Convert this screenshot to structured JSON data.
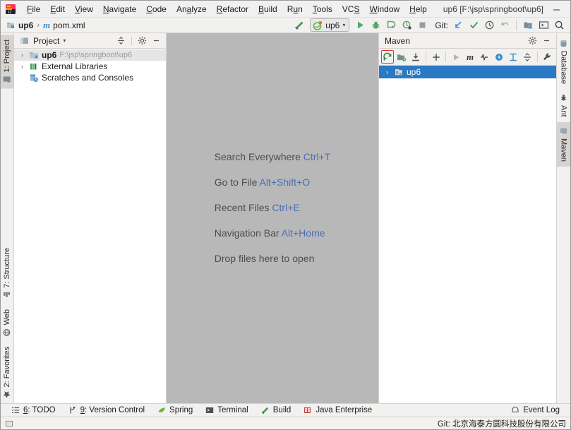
{
  "window": {
    "title": "up6 [F:\\jsp\\springboot\\up6]",
    "minimize": "—",
    "maximize": "☐",
    "close": "✕",
    "logo_icon": "intellij-idea-logo"
  },
  "menubar": {
    "items": [
      {
        "label": "File",
        "mnemonic": "F"
      },
      {
        "label": "Edit",
        "mnemonic": "E"
      },
      {
        "label": "View",
        "mnemonic": "V"
      },
      {
        "label": "Navigate",
        "mnemonic": "N"
      },
      {
        "label": "Code",
        "mnemonic": "C"
      },
      {
        "label": "Analyze",
        "mnemonic": "A"
      },
      {
        "label": "Refactor",
        "mnemonic": "R"
      },
      {
        "label": "Build",
        "mnemonic": "B"
      },
      {
        "label": "Run",
        "mnemonic": "u"
      },
      {
        "label": "Tools",
        "mnemonic": "T"
      },
      {
        "label": "VCS",
        "mnemonic": "S"
      },
      {
        "label": "Window",
        "mnemonic": "W"
      },
      {
        "label": "Help",
        "mnemonic": "H"
      }
    ]
  },
  "breadcrumb": {
    "project": "up6",
    "separator": "›",
    "file": "pom.xml",
    "file_icon": "maven-m-icon",
    "project_icon": "module-folder-icon"
  },
  "toolbar": {
    "build_icon": "build-hammer-icon",
    "run_config": {
      "name": "up6",
      "icon": "spring-boot-icon",
      "chevron": "∨"
    },
    "run_icon": "run-play-icon",
    "debug_icon": "debug-bug-icon",
    "run_coverage_icon": "run-with-coverage-icon",
    "profile_icon": "profiler-icon",
    "stop_icon": "stop-square-icon",
    "git_label": "Git:",
    "update_project_icon": "update-project-arrow-icon",
    "commit_icon": "commit-checkmark-icon",
    "history_icon": "vcs-history-clock-icon",
    "rollback_icon": "rollback-undo-icon",
    "project_structure_icon": "project-structure-icon",
    "terminal_icon": "terminal-screen-icon",
    "search_icon": "search-magnifier-icon"
  },
  "left_rail": {
    "top": [
      {
        "label": "1: Project",
        "icon": "project-window-icon",
        "active": true
      }
    ],
    "bottom": [
      {
        "label": "7: Structure",
        "icon": "structure-icon"
      },
      {
        "label": "Web",
        "icon": "web-globe-icon"
      },
      {
        "label": "2: Favorites",
        "icon": "favorites-star-icon"
      }
    ]
  },
  "right_rail": {
    "items": [
      {
        "label": "Database",
        "icon": "database-icon"
      },
      {
        "label": "Ant",
        "icon": "ant-icon"
      },
      {
        "label": "Maven",
        "icon": "maven-m-icon",
        "active": true
      }
    ]
  },
  "project_panel": {
    "title": "Project",
    "title_chevron": "▾",
    "collapse_icon": "collapse-all-icon",
    "settings_icon": "gear-icon",
    "hide_icon": "hide-minimize-icon",
    "tree": [
      {
        "label": "up6",
        "path": "F:\\jsp\\springboot\\up6",
        "arrow": "›",
        "icon": "module-folder-icon",
        "selected": true,
        "bold": true
      },
      {
        "label": "External Libraries",
        "path": "",
        "arrow": "›",
        "icon": "external-libraries-icon",
        "selected": false,
        "bold": false
      },
      {
        "label": "Scratches and Consoles",
        "path": "",
        "arrow": "",
        "icon": "scratches-icon",
        "selected": false,
        "bold": false
      }
    ]
  },
  "editor": {
    "tips": [
      {
        "action": "Search Everywhere",
        "shortcut": "Ctrl+T"
      },
      {
        "action": "Go to File",
        "shortcut": "Alt+Shift+O"
      },
      {
        "action": "Recent Files",
        "shortcut": "Ctrl+E"
      },
      {
        "action": "Navigation Bar",
        "shortcut": "Alt+Home"
      },
      {
        "action": "Drop files here to open",
        "shortcut": ""
      }
    ]
  },
  "maven_panel": {
    "title": "Maven",
    "settings_icon": "gear-icon",
    "hide_icon": "hide-minimize-icon",
    "toolbar": [
      {
        "name": "reload-all-maven-projects-icon",
        "highlighted": true
      },
      {
        "name": "generate-sources-icon",
        "highlighted": false
      },
      {
        "name": "download-sources-icon",
        "highlighted": false
      },
      {
        "name": "add-maven-project-icon",
        "highlighted": false
      },
      {
        "name": "run-maven-build-icon",
        "highlighted": false
      },
      {
        "name": "execute-maven-goal-icon",
        "highlighted": false
      },
      {
        "name": "toggle-skip-tests-icon",
        "highlighted": false
      },
      {
        "name": "toggle-offline-mode-icon",
        "highlighted": false
      },
      {
        "name": "show-dependencies-icon",
        "highlighted": false
      },
      {
        "name": "collapse-all-icon",
        "highlighted": false
      },
      {
        "name": "maven-settings-wrench-icon",
        "highlighted": false
      }
    ],
    "tree": [
      {
        "label": "up6",
        "arrow": "›",
        "icon": "maven-project-icon",
        "selected": true
      }
    ]
  },
  "statusbar": {
    "items": [
      {
        "label": "6: TODO",
        "mnemonic": "6",
        "icon": "todo-list-icon"
      },
      {
        "label": "9: Version Control",
        "mnemonic": "9",
        "icon": "version-control-branch-icon"
      },
      {
        "label": "Spring",
        "mnemonic": "",
        "icon": "spring-leaf-icon"
      },
      {
        "label": "Terminal",
        "mnemonic": "",
        "icon": "terminal-screen-icon"
      },
      {
        "label": "Build",
        "mnemonic": "",
        "icon": "build-hammer-icon"
      },
      {
        "label": "Java Enterprise",
        "mnemonic": "",
        "icon": "java-enterprise-icon"
      }
    ],
    "event_log": "Event Log",
    "event_log_icon": "event-log-icon",
    "git_status": "Git: 北京海泰方圆科技股份有限公司",
    "memory_icon": "memory-indicator-icon"
  },
  "colors": {
    "accent_blue": "#2b78c4",
    "shortcut_blue": "#4a6fb5",
    "editor_bg": "#b8b8b8",
    "panel_bg": "#f2f1f0",
    "highlight_red": "#e0362c",
    "green": "#389e39"
  }
}
